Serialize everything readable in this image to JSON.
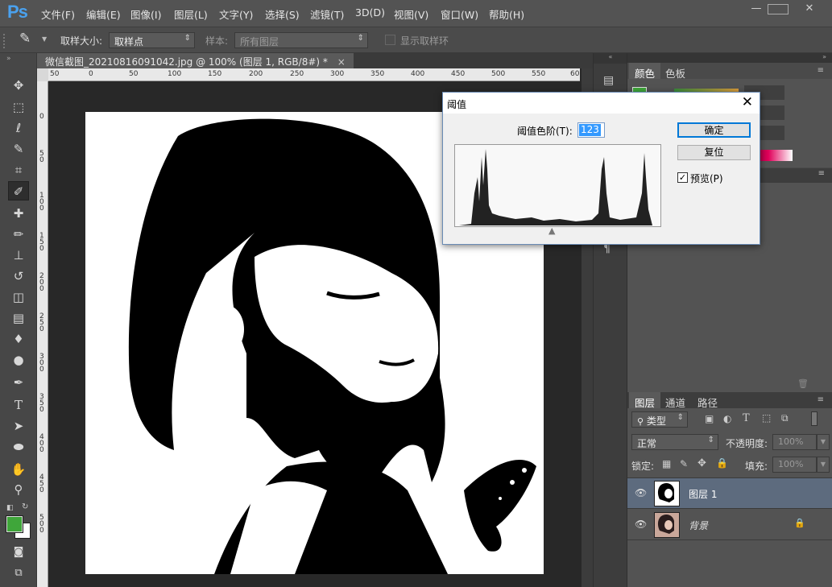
{
  "app": {
    "logo": "Ps"
  },
  "menu": [
    "文件(F)",
    "编辑(E)",
    "图像(I)",
    "图层(L)",
    "文字(Y)",
    "选择(S)",
    "滤镜(T)",
    "3D(D)",
    "视图(V)",
    "窗口(W)",
    "帮助(H)"
  ],
  "window_controls": {
    "minimize": "—",
    "restore": "□",
    "close": "✕"
  },
  "options": {
    "sample_size_label": "取样大小:",
    "sample_size_value": "取样点",
    "sample_label": "样本:",
    "sample_value": "所有图层",
    "show_ring_label": "显示取样环"
  },
  "document": {
    "tab_title": "微信截图_20210816091042.jpg @ 100% (图层 1, RGB/8#) *",
    "close": "×",
    "ruler_h": [
      "50",
      "0",
      "50",
      "100",
      "150",
      "200",
      "250",
      "300",
      "350",
      "400",
      "450",
      "500",
      "550",
      "60"
    ],
    "ruler_v": [
      "0",
      "50",
      "100",
      "150",
      "200",
      "250",
      "300",
      "350",
      "400",
      "450",
      "500"
    ]
  },
  "threshold_dialog": {
    "title": "阈值",
    "level_label": "阈值色阶(T):",
    "level_value": "123",
    "ok": "确定",
    "reset": "复位",
    "preview_label": "预览(P)",
    "preview_checked": true
  },
  "color_panel": {
    "tabs": [
      "颜色",
      "色板"
    ]
  },
  "layers_panel": {
    "tabs": [
      "图层",
      "通道",
      "路径"
    ],
    "filter_label": "类型",
    "blend_mode": "正常",
    "opacity_label": "不透明度:",
    "opacity_value": "100%",
    "lock_label": "锁定:",
    "fill_label": "填充:",
    "fill_value": "100%",
    "layers": [
      {
        "name": "图层 1",
        "selected": true
      },
      {
        "name": "背景",
        "locked": true
      }
    ]
  },
  "colors": {
    "foreground": "#3fa63a",
    "background": "#ffffff",
    "accent": "#4aa1ee"
  }
}
